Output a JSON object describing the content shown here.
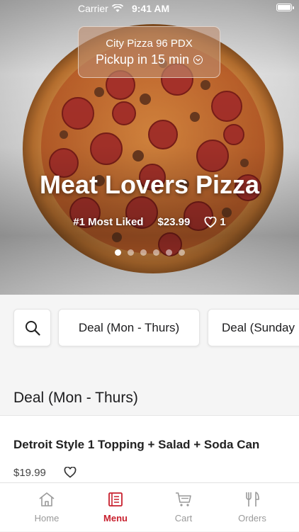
{
  "status_bar": {
    "carrier": "Carrier",
    "time": "9:41 AM"
  },
  "store": {
    "name": "City Pizza 96 PDX",
    "pickup": "Pickup in 15 min"
  },
  "hero": {
    "title": "Meat Lovers Pizza",
    "rank": "#1 Most Liked",
    "price": "$23.99",
    "likes": "1",
    "carousel": {
      "count": 6,
      "active": 1
    }
  },
  "categories": [
    "Deal (Mon - Thurs)",
    "Deal (Sunday"
  ],
  "section": {
    "title": "Deal (Mon - Thurs)"
  },
  "items": [
    {
      "name": "Detroit Style 1 Topping + Salad + Soda Can",
      "price": "$19.99"
    }
  ],
  "tabs": [
    {
      "label": "Home",
      "icon": "home-icon"
    },
    {
      "label": "Menu",
      "icon": "menu-icon",
      "active": true
    },
    {
      "label": "Cart",
      "icon": "cart-icon"
    },
    {
      "label": "Orders",
      "icon": "fork-knife-icon"
    }
  ],
  "colors": {
    "accent": "#c8202e",
    "inactive": "#9a9a9a"
  }
}
